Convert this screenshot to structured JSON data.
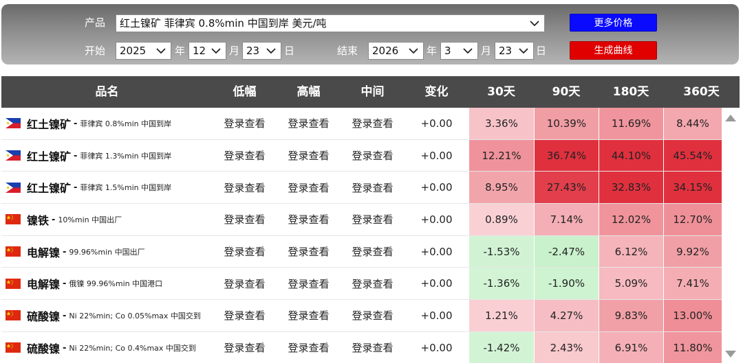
{
  "filters": {
    "product_label": "产品",
    "product_value": "红土镍矿 菲律宾 0.8%min 中国到岸 美元/吨",
    "start_label": "开始",
    "start_year": "2025",
    "start_month": "12",
    "start_day": "23",
    "end_label": "结束",
    "end_year": "2026",
    "end_month": "3",
    "end_day": "23",
    "year_unit": "年",
    "month_unit": "月",
    "day_unit": "日",
    "more_prices_button": "更多价格",
    "generate_curve_button": "生成曲线"
  },
  "table": {
    "headers": [
      "品名",
      "低幅",
      "高幅",
      "中间",
      "变化",
      "30天",
      "90天",
      "180天",
      "360天"
    ],
    "rows": [
      {
        "flag": "philippines",
        "name": "红土镍矿",
        "spec": "菲律宾 0.8%min 中国到岸",
        "low": "登录查看",
        "high": "登录查看",
        "mid": "登录查看",
        "change": "+0.00",
        "d30": "3.36%",
        "d90": "10.39%",
        "d180": "11.69%",
        "d360": "8.44%"
      },
      {
        "flag": "philippines",
        "name": "红土镍矿",
        "spec": "菲律宾 1.3%min 中国到岸",
        "low": "登录查看",
        "high": "登录查看",
        "mid": "登录查看",
        "change": "+0.00",
        "d30": "12.21%",
        "d90": "36.74%",
        "d180": "44.10%",
        "d360": "45.54%"
      },
      {
        "flag": "philippines",
        "name": "红土镍矿",
        "spec": "菲律宾 1.5%min 中国到岸",
        "low": "登录查看",
        "high": "登录查看",
        "mid": "登录查看",
        "change": "+0.00",
        "d30": "8.95%",
        "d90": "27.43%",
        "d180": "32.83%",
        "d360": "34.15%"
      },
      {
        "flag": "china",
        "name": "镍铁",
        "spec": "10%min 中国出厂",
        "low": "登录查看",
        "high": "登录查看",
        "mid": "登录查看",
        "change": "+0.00",
        "d30": "0.89%",
        "d90": "7.14%",
        "d180": "12.02%",
        "d360": "12.70%"
      },
      {
        "flag": "china",
        "name": "电解镍",
        "spec": "99.96%min 中国出厂",
        "low": "登录查看",
        "high": "登录查看",
        "mid": "登录查看",
        "change": "+0.00",
        "d30": "-1.53%",
        "d90": "-2.47%",
        "d180": "6.12%",
        "d360": "9.92%"
      },
      {
        "flag": "china",
        "name": "电解镍",
        "spec": "俄镍 99.96%min 中国港口",
        "low": "登录查看",
        "high": "登录查看",
        "mid": "登录查看",
        "change": "+0.00",
        "d30": "-1.36%",
        "d90": "-1.90%",
        "d180": "5.09%",
        "d360": "7.41%"
      },
      {
        "flag": "china",
        "name": "硫酸镍",
        "spec": "Ni 22%min; Co 0.05%max 中国交到",
        "low": "登录查看",
        "high": "登录查看",
        "mid": "登录查看",
        "change": "+0.00",
        "d30": "1.21%",
        "d90": "4.27%",
        "d180": "9.83%",
        "d360": "13.00%"
      },
      {
        "flag": "china",
        "name": "硫酸镍",
        "spec": "Ni 22%min; Co 0.4%max 中国交到",
        "low": "登录查看",
        "high": "登录查看",
        "mid": "登录查看",
        "change": "+0.00",
        "d30": "-1.42%",
        "d90": "2.43%",
        "d180": "6.91%",
        "d360": "11.80%"
      }
    ]
  },
  "colors": {
    "header_bg": "#4a4a4a",
    "positive_max": "#e0303e",
    "negative": "#c8f0cc",
    "button_blue": "#0a0aff",
    "button_red": "#e00000"
  },
  "icons": {
    "select_arrow": "chevron-down-icon",
    "scroll_up": "triangle-up-icon",
    "scroll_down": "triangle-down-icon"
  }
}
